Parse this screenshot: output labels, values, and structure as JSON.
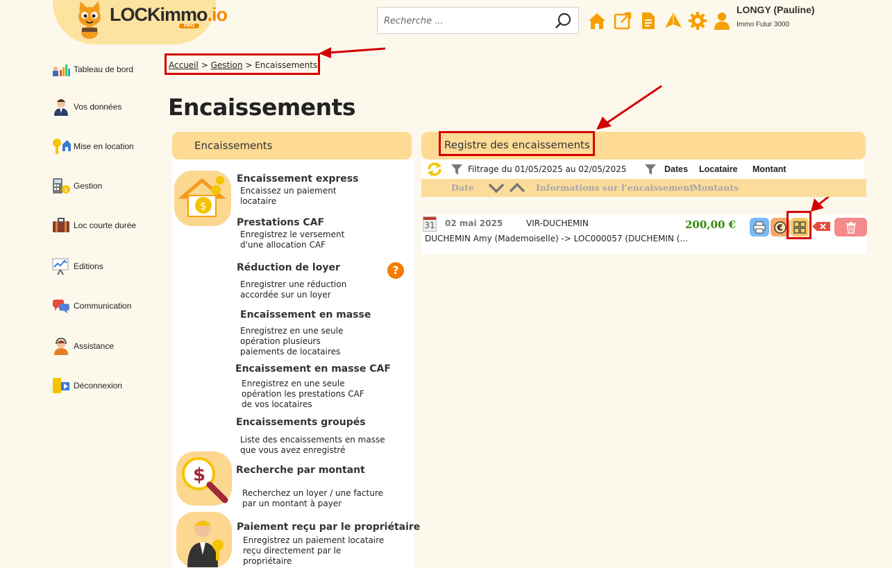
{
  "brand": {
    "name_main": "LOCKimmo",
    "name_suffix": ".io",
    "badge": "PRO"
  },
  "search": {
    "placeholder": "Recherche ..."
  },
  "user": {
    "name": "LONGY (Pauline)",
    "company": "Immo Futur 3000"
  },
  "header_icons": [
    "home-icon",
    "external-link-icon",
    "document-icon",
    "paper-plane-icon",
    "gear-icon",
    "user-icon"
  ],
  "sidebar": {
    "items": [
      {
        "label": "Tableau de bord",
        "icon": "dashboard-icon"
      },
      {
        "label": "Vos données",
        "icon": "person-icon"
      },
      {
        "label": "Mise en location",
        "icon": "keys-house-icon"
      },
      {
        "label": "Gestion",
        "icon": "calculator-icon"
      },
      {
        "label": "Loc courte durée",
        "icon": "suitcase-icon"
      },
      {
        "label": "Editions",
        "icon": "chart-board-icon"
      },
      {
        "label": "Communication",
        "icon": "chat-bubbles-icon"
      },
      {
        "label": "Assistance",
        "icon": "headset-icon"
      },
      {
        "label": "Déconnexion",
        "icon": "exit-door-icon"
      }
    ]
  },
  "breadcrumb": {
    "home": "Accueil",
    "gestion": "Gestion",
    "sep": ">",
    "current": "Encaissements"
  },
  "page": {
    "title": "Encaissements"
  },
  "left_panel": {
    "title": "Encaissements",
    "items": [
      {
        "title": "Encaissement express",
        "desc": "Encaissez un paiement\nlocataire"
      },
      {
        "title": "Prestations CAF",
        "desc": "Enregistrez le versement\nd'une allocation CAF"
      },
      {
        "title": "Réduction de loyer",
        "desc": "Enregistrer une réduction\naccordée sur un loyer"
      },
      {
        "title": "Encaissement en masse",
        "desc": "Enregistrez en une seule\nopération plusieurs\npaiements de locataires"
      },
      {
        "title": "Encaissement en masse CAF",
        "desc": "Enregistrez en une seule\nopération les prestations CAF\nde vos locataires"
      },
      {
        "title": "Encaissements groupés",
        "desc": "Liste des encaissements en masse\nque vous avez enregistré"
      },
      {
        "title": "Recherche par montant",
        "desc": "Recherchez un loyer / une facture\npar un montant à payer"
      },
      {
        "title": "Paiement reçu par le propriétaire",
        "desc": "Enregistrez un paiement locataire\nreçu directement par le\npropriétaire"
      }
    ],
    "help_glyph": "?"
  },
  "register": {
    "title": "Registre des encaissements",
    "filter_text": "Filtrage du 01/05/2025 au 02/05/2025",
    "filter_fields": [
      "Dates",
      "Locataire",
      "Montant"
    ],
    "sort": {
      "date": "Date",
      "info": "Informations sur l'encaissement",
      "amounts": "Montants"
    },
    "entries": [
      {
        "calendar_day": "31",
        "date": "02 mai 2025",
        "reference": "VIR-DUCHEMIN",
        "amount": "200,00 €",
        "details": "DUCHEMIN Amy (Mademoiselle) -> LOC000057 (DUCHEMIN (..."
      }
    ],
    "action_icons": [
      "printer-icon",
      "euro-icon",
      "grid-icon",
      "cancel-icon",
      "trash-icon"
    ]
  },
  "colors": {
    "accent": "#f5a000",
    "panel": "#fddb95",
    "annotation": "#d40000",
    "amount": "#2e8b00"
  }
}
